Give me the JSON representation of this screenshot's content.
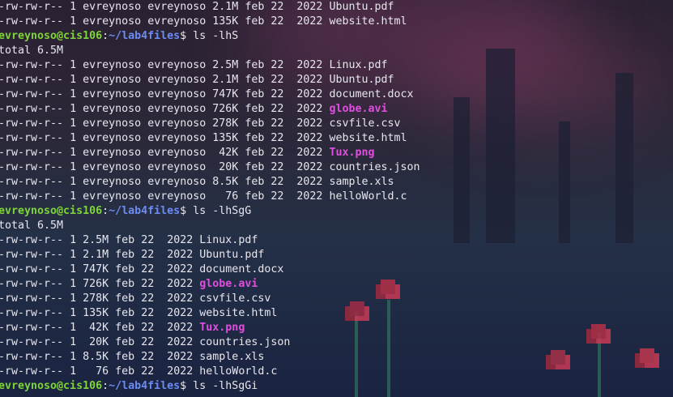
{
  "terminal": {
    "lines": [
      {
        "type": "file",
        "perm": "-rw-rw-r--",
        "links": "1",
        "owner": "evreynoso",
        "group": "evreynoso",
        "size": "2.1M",
        "month": "feb",
        "day": "22",
        "year": "2022",
        "name": "Ubuntu.pdf",
        "kind": "normal"
      },
      {
        "type": "file",
        "perm": "-rw-rw-r--",
        "links": "1",
        "owner": "evreynoso",
        "group": "evreynoso",
        "size": "135K",
        "month": "feb",
        "day": "22",
        "year": "2022",
        "name": "website.html",
        "kind": "normal"
      },
      {
        "type": "prompt",
        "user": "evreynoso@cis106",
        "sep": ":",
        "path": "~/lab4files",
        "symbol": "$",
        "command": "ls -lhS"
      },
      {
        "type": "text",
        "text": "total 6.5M"
      },
      {
        "type": "file",
        "perm": "-rw-rw-r--",
        "links": "1",
        "owner": "evreynoso",
        "group": "evreynoso",
        "size": "2.5M",
        "month": "feb",
        "day": "22",
        "year": "2022",
        "name": "Linux.pdf",
        "kind": "normal"
      },
      {
        "type": "file",
        "perm": "-rw-rw-r--",
        "links": "1",
        "owner": "evreynoso",
        "group": "evreynoso",
        "size": "2.1M",
        "month": "feb",
        "day": "22",
        "year": "2022",
        "name": "Ubuntu.pdf",
        "kind": "normal"
      },
      {
        "type": "file",
        "perm": "-rw-rw-r--",
        "links": "1",
        "owner": "evreynoso",
        "group": "evreynoso",
        "size": "747K",
        "month": "feb",
        "day": "22",
        "year": "2022",
        "name": "document.docx",
        "kind": "normal"
      },
      {
        "type": "file",
        "perm": "-rw-rw-r--",
        "links": "1",
        "owner": "evreynoso",
        "group": "evreynoso",
        "size": "726K",
        "month": "feb",
        "day": "22",
        "year": "2022",
        "name": "globe.avi",
        "kind": "media"
      },
      {
        "type": "file",
        "perm": "-rw-rw-r--",
        "links": "1",
        "owner": "evreynoso",
        "group": "evreynoso",
        "size": "278K",
        "month": "feb",
        "day": "22",
        "year": "2022",
        "name": "csvfile.csv",
        "kind": "normal"
      },
      {
        "type": "file",
        "perm": "-rw-rw-r--",
        "links": "1",
        "owner": "evreynoso",
        "group": "evreynoso",
        "size": "135K",
        "month": "feb",
        "day": "22",
        "year": "2022",
        "name": "website.html",
        "kind": "normal"
      },
      {
        "type": "file",
        "perm": "-rw-rw-r--",
        "links": "1",
        "owner": "evreynoso",
        "group": "evreynoso",
        "size": " 42K",
        "month": "feb",
        "day": "22",
        "year": "2022",
        "name": "Tux.png",
        "kind": "media"
      },
      {
        "type": "file",
        "perm": "-rw-rw-r--",
        "links": "1",
        "owner": "evreynoso",
        "group": "evreynoso",
        "size": " 20K",
        "month": "feb",
        "day": "22",
        "year": "2022",
        "name": "countries.json",
        "kind": "normal"
      },
      {
        "type": "file",
        "perm": "-rw-rw-r--",
        "links": "1",
        "owner": "evreynoso",
        "group": "evreynoso",
        "size": "8.5K",
        "month": "feb",
        "day": "22",
        "year": "2022",
        "name": "sample.xls",
        "kind": "normal"
      },
      {
        "type": "file",
        "perm": "-rw-rw-r--",
        "links": "1",
        "owner": "evreynoso",
        "group": "evreynoso",
        "size": "  76",
        "month": "feb",
        "day": "22",
        "year": "2022",
        "name": "helloWorld.c",
        "kind": "normal"
      },
      {
        "type": "prompt",
        "user": "evreynoso@cis106",
        "sep": ":",
        "path": "~/lab4files",
        "symbol": "$",
        "command": "ls -lhSgG"
      },
      {
        "type": "text",
        "text": "total 6.5M"
      },
      {
        "type": "short",
        "perm": "-rw-rw-r--",
        "links": "1",
        "size": "2.5M",
        "month": "feb",
        "day": "22",
        "year": "2022",
        "name": "Linux.pdf",
        "kind": "normal"
      },
      {
        "type": "short",
        "perm": "-rw-rw-r--",
        "links": "1",
        "size": "2.1M",
        "month": "feb",
        "day": "22",
        "year": "2022",
        "name": "Ubuntu.pdf",
        "kind": "normal"
      },
      {
        "type": "short",
        "perm": "-rw-rw-r--",
        "links": "1",
        "size": "747K",
        "month": "feb",
        "day": "22",
        "year": "2022",
        "name": "document.docx",
        "kind": "normal"
      },
      {
        "type": "short",
        "perm": "-rw-rw-r--",
        "links": "1",
        "size": "726K",
        "month": "feb",
        "day": "22",
        "year": "2022",
        "name": "globe.avi",
        "kind": "media"
      },
      {
        "type": "short",
        "perm": "-rw-rw-r--",
        "links": "1",
        "size": "278K",
        "month": "feb",
        "day": "22",
        "year": "2022",
        "name": "csvfile.csv",
        "kind": "normal"
      },
      {
        "type": "short",
        "perm": "-rw-rw-r--",
        "links": "1",
        "size": "135K",
        "month": "feb",
        "day": "22",
        "year": "2022",
        "name": "website.html",
        "kind": "normal"
      },
      {
        "type": "short",
        "perm": "-rw-rw-r--",
        "links": "1",
        "size": " 42K",
        "month": "feb",
        "day": "22",
        "year": "2022",
        "name": "Tux.png",
        "kind": "media"
      },
      {
        "type": "short",
        "perm": "-rw-rw-r--",
        "links": "1",
        "size": " 20K",
        "month": "feb",
        "day": "22",
        "year": "2022",
        "name": "countries.json",
        "kind": "normal"
      },
      {
        "type": "short",
        "perm": "-rw-rw-r--",
        "links": "1",
        "size": "8.5K",
        "month": "feb",
        "day": "22",
        "year": "2022",
        "name": "sample.xls",
        "kind": "normal"
      },
      {
        "type": "short",
        "perm": "-rw-rw-r--",
        "links": "1",
        "size": "  76",
        "month": "feb",
        "day": "22",
        "year": "2022",
        "name": "helloWorld.c",
        "kind": "normal"
      },
      {
        "type": "prompt",
        "user": "evreynoso@cis106",
        "sep": ":",
        "path": "~/lab4files",
        "symbol": "$",
        "command": "ls -lhSgGi"
      }
    ]
  },
  "colors": {
    "text": "#e8e6ee",
    "prompt_user": "#7fd437",
    "prompt_path": "#6c8cf2",
    "media_file": "#e04ee0"
  }
}
